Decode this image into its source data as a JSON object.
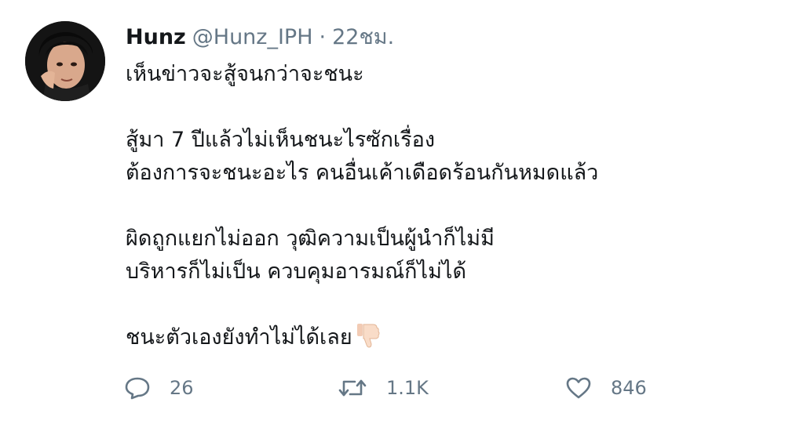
{
  "tweet": {
    "display_name": "Hunz",
    "handle": "@Hunz_IPH",
    "separator": "·",
    "time": "22ชม.",
    "lines": [
      "เห็นข่าวจะสู้จนกว่าจะชนะ",
      "",
      "สู้มา 7 ปีแล้วไม่เห็นชนะไรซักเรื่อง",
      "ต้องการจะชนะอะไร คนอื่นเค้าเดือดร้อนกันหมดแล้ว",
      "",
      "ผิดถูกแยกไม่ออก วุฒิความเป็นผู้นำก็ไม่มี",
      "บริหารก็ไม่เป็น ควบคุมอารมณ์ก็ไม่ได้",
      "",
      "ชนะตัวเองยังทำไม่ได้เลย"
    ],
    "emoji": "thumbs-down-icon"
  },
  "actions": {
    "reply_count": "26",
    "retweet_count": "1.1K",
    "like_count": "846"
  },
  "colors": {
    "text": "#14171a",
    "muted": "#657786"
  }
}
